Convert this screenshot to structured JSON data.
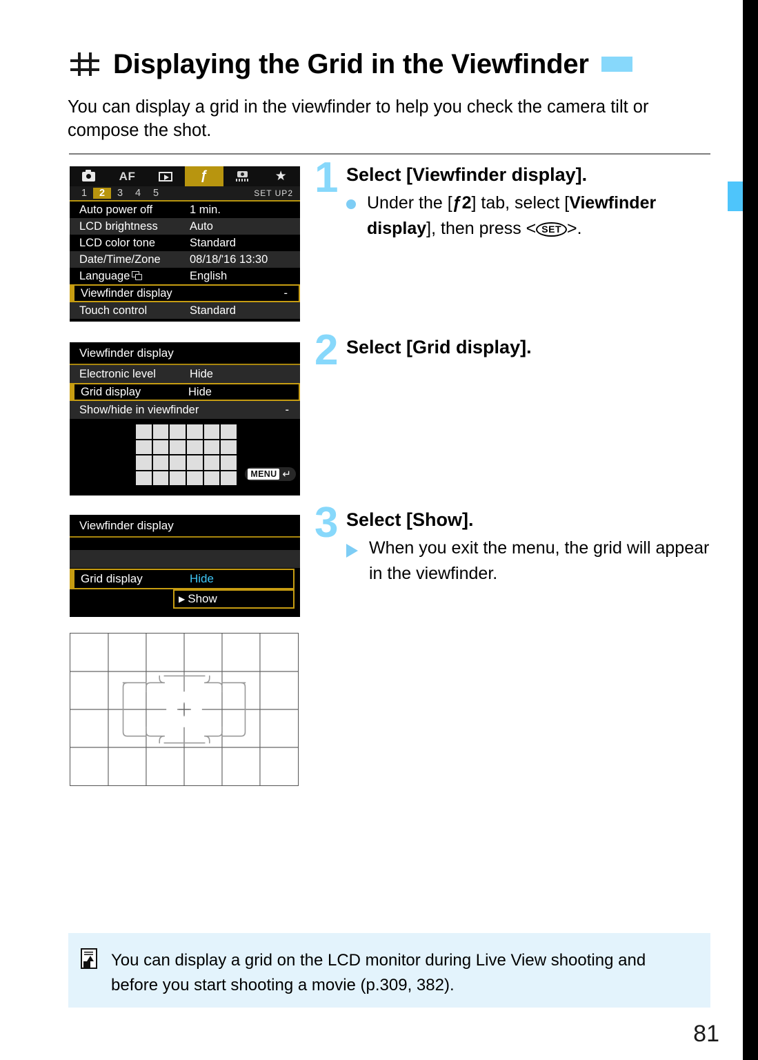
{
  "page": {
    "title": "Displaying the Grid in the Viewfinder",
    "title_icon": "grid-icon",
    "intro": "You can display a grid in the viewfinder to help you check the camera tilt or compose the shot.",
    "page_number": "81"
  },
  "screens": {
    "menu_setup2": {
      "tabs": [
        {
          "icon": "camera-icon",
          "label": "",
          "active": false
        },
        {
          "icon": "af-icon",
          "label": "AF",
          "active": false
        },
        {
          "icon": "playback-icon",
          "label": "",
          "active": false
        },
        {
          "icon": "wrench-icon",
          "label": "ƒ",
          "active": true
        },
        {
          "icon": "custom-functions-icon",
          "label": "",
          "active": false
        },
        {
          "icon": "star-icon",
          "label": "★",
          "active": false
        }
      ],
      "pages": [
        "1",
        "2",
        "3",
        "4",
        "5"
      ],
      "selected_page": "2",
      "screen_label": "SET UP2",
      "rows": [
        {
          "label": "Auto power off",
          "value": "1 min.",
          "selected": false
        },
        {
          "label": "LCD brightness",
          "value": "Auto",
          "selected": false
        },
        {
          "label": "LCD color tone",
          "value": "Standard",
          "selected": false
        },
        {
          "label": "Date/Time/Zone",
          "value": "08/18/'16 13:30",
          "selected": false
        },
        {
          "label": "Language",
          "value": "English",
          "selected": false,
          "icon": "language-icon"
        },
        {
          "label": "Viewfinder display",
          "value": "-",
          "selected": true
        },
        {
          "label": "Touch control",
          "value": "Standard",
          "selected": false
        }
      ]
    },
    "viewfinder_display": {
      "title": "Viewfinder display",
      "rows": [
        {
          "label": "Electronic level",
          "value": "Hide",
          "selected": false
        },
        {
          "label": "Grid display",
          "value": "Hide",
          "selected": true
        },
        {
          "label": "Show/hide in viewfinder",
          "value": "-",
          "selected": false
        }
      ],
      "preview_grid": {
        "columns": 6,
        "rows": 4
      },
      "menu_button": "MENU",
      "menu_button_icon": "return-arrow-icon"
    },
    "grid_display_dropdown": {
      "title": "Viewfinder display",
      "setting_label": "Grid display",
      "current_value": "Hide",
      "options": [
        "Hide",
        "Show"
      ],
      "highlighted_option": "Show"
    }
  },
  "viewfinder_diagram": {
    "grid_columns": 6,
    "grid_rows": 4,
    "has_af_area_outline": true,
    "has_center_crosshair": true
  },
  "steps": [
    {
      "number": "1",
      "heading": "Select [Viewfinder display].",
      "marker": "bullet",
      "body_prefix": "Under the [",
      "body_tab": "2",
      "body_mid": "] tab, select [",
      "body_bold": "Viewfinder display",
      "body_suffix": "], then press <",
      "body_key": "SET",
      "body_end": ">."
    },
    {
      "number": "2",
      "heading": "Select [Grid display].",
      "marker": "none",
      "body": ""
    },
    {
      "number": "3",
      "heading": "Select [Show].",
      "marker": "triangle",
      "body": "When you exit the menu, the grid will appear in the viewfinder."
    }
  ],
  "note": {
    "icon": "memo-note-icon",
    "text": "You can display a grid on the LCD monitor during Live View shooting and before you start shooting a movie (p.309, 382)."
  },
  "colors": {
    "accent_blue": "#87d8fb",
    "edge_tab_blue": "#4ec5fb",
    "menu_gold": "#b8950f",
    "menu_highlight_border": "#c79d12",
    "value_cyan": "#3fc6f5",
    "note_bg": "#e3f3fc"
  }
}
